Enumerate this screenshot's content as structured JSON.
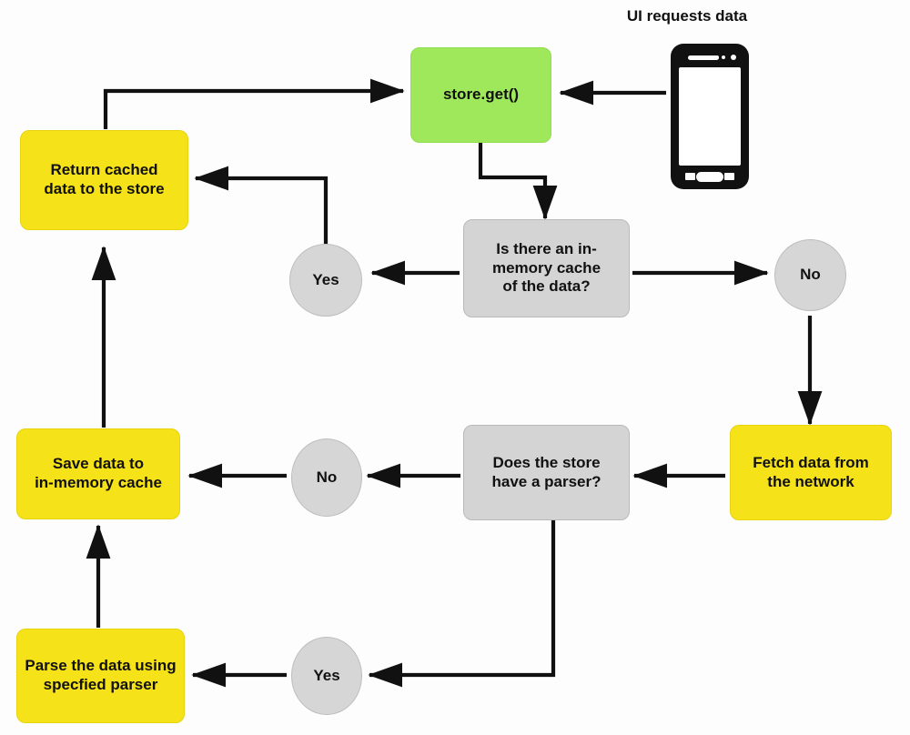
{
  "diagram": {
    "title": "UI requests data",
    "colors": {
      "green": "#9FE85C",
      "yellow": "#F6E218",
      "gray_box": "#D4D4D4",
      "gray_circle": "#D6D6D6",
      "arrow": "#111111",
      "background": "#FDFDFD"
    },
    "nodes": {
      "store_get": "store.get()",
      "return_cached": "Return cached\ndata to the store",
      "cache_question": "Is there an in-\nmemory cache\nof the data?",
      "yes_cache": "Yes",
      "no_cache": "No",
      "fetch_network": "Fetch data from\nthe network",
      "parser_question": "Does the store\nhave a parser?",
      "no_parser": "No",
      "save_cache": "Save data to\nin-memory cache",
      "yes_parser": "Yes",
      "parse_data": "Parse the data using\nspecfied parser"
    },
    "phone": {
      "label": "ui-device-phone"
    }
  },
  "chart_data": {
    "type": "diagram",
    "title": "UI requests data",
    "nodes": [
      {
        "id": "phone",
        "label": "UI requests data",
        "shape": "device",
        "color": "#111111"
      },
      {
        "id": "store_get",
        "label": "store.get()",
        "shape": "rounded-rect",
        "color": "#9FE85C"
      },
      {
        "id": "return_cached",
        "label": "Return cached data to the store",
        "shape": "rounded-rect",
        "color": "#F6E218"
      },
      {
        "id": "cache_question",
        "label": "Is there an in-memory cache of the data?",
        "shape": "rounded-rect",
        "color": "#D4D4D4"
      },
      {
        "id": "yes_cache",
        "label": "Yes",
        "shape": "circle",
        "color": "#D6D6D6"
      },
      {
        "id": "no_cache",
        "label": "No",
        "shape": "circle",
        "color": "#D6D6D6"
      },
      {
        "id": "fetch_network",
        "label": "Fetch data from the network",
        "shape": "rounded-rect",
        "color": "#F6E218"
      },
      {
        "id": "parser_question",
        "label": "Does the store have a parser?",
        "shape": "rounded-rect",
        "color": "#D4D4D4"
      },
      {
        "id": "no_parser",
        "label": "No",
        "shape": "circle",
        "color": "#D6D6D6"
      },
      {
        "id": "save_cache",
        "label": "Save data to in-memory cache",
        "shape": "rounded-rect",
        "color": "#F6E218"
      },
      {
        "id": "yes_parser",
        "label": "Yes",
        "shape": "circle",
        "color": "#D6D6D6"
      },
      {
        "id": "parse_data",
        "label": "Parse the data using specfied parser",
        "shape": "rounded-rect",
        "color": "#F6E218"
      }
    ],
    "edges": [
      {
        "from": "phone",
        "to": "store_get"
      },
      {
        "from": "store_get",
        "to": "cache_question"
      },
      {
        "from": "cache_question",
        "to": "yes_cache"
      },
      {
        "from": "cache_question",
        "to": "no_cache"
      },
      {
        "from": "yes_cache",
        "to": "return_cached"
      },
      {
        "from": "return_cached",
        "to": "store_get"
      },
      {
        "from": "no_cache",
        "to": "fetch_network"
      },
      {
        "from": "fetch_network",
        "to": "parser_question"
      },
      {
        "from": "parser_question",
        "to": "no_parser"
      },
      {
        "from": "no_parser",
        "to": "save_cache"
      },
      {
        "from": "save_cache",
        "to": "return_cached"
      },
      {
        "from": "parser_question",
        "to": "yes_parser"
      },
      {
        "from": "yes_parser",
        "to": "parse_data"
      },
      {
        "from": "parse_data",
        "to": "save_cache"
      }
    ]
  }
}
